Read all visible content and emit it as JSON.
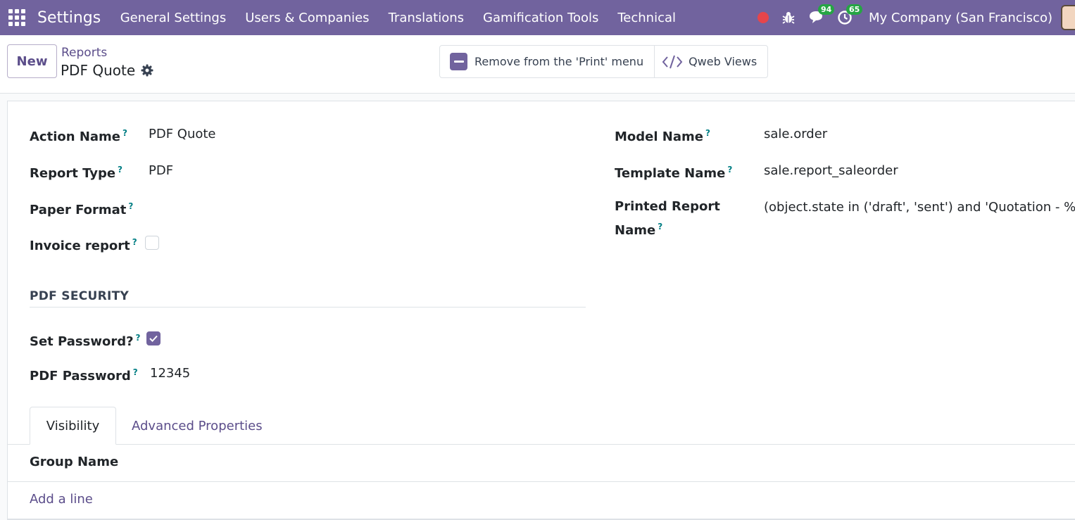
{
  "navbar": {
    "app_title": "Settings",
    "menu": [
      "General Settings",
      "Users & Companies",
      "Translations",
      "Gamification Tools",
      "Technical"
    ],
    "messages_count": "94",
    "activities_count": "65",
    "company": "My Company (San Francisco)"
  },
  "control_panel": {
    "new_label": "New",
    "breadcrumb": "Reports",
    "record_title": "PDF Quote",
    "remove_print_label": "Remove from the 'Print' menu",
    "qweb_views_label": "Qweb Views"
  },
  "form": {
    "action_name": {
      "label": "Action Name",
      "value": "PDF Quote"
    },
    "report_type": {
      "label": "Report Type",
      "value": "PDF"
    },
    "paper_format": {
      "label": "Paper Format",
      "value": ""
    },
    "invoice_report": {
      "label": "Invoice report",
      "checked": false
    },
    "model_name": {
      "label": "Model Name",
      "value": "sale.order"
    },
    "template_name": {
      "label": "Template Name",
      "value": "sale.report_saleorder"
    },
    "printed_report_name": {
      "label_line1": "Printed Report",
      "label_line2": "Name",
      "value": "(object.state in ('draft', 'sent') and 'Quotation - %s"
    },
    "pdf_security_title": "PDF SECURITY",
    "set_password": {
      "label": "Set Password?",
      "checked": true
    },
    "pdf_password": {
      "label": "PDF Password",
      "value": "12345"
    },
    "help_mark": "?"
  },
  "tabs": {
    "visibility": "Visibility",
    "advanced": "Advanced Properties"
  },
  "groups_table": {
    "column_header": "Group Name",
    "add_line": "Add a line"
  },
  "colors": {
    "brand": "#71639e",
    "link": "#5b4d8a",
    "help": "#017e84",
    "badge": "#26a544",
    "record_dot": "#e6454b"
  }
}
